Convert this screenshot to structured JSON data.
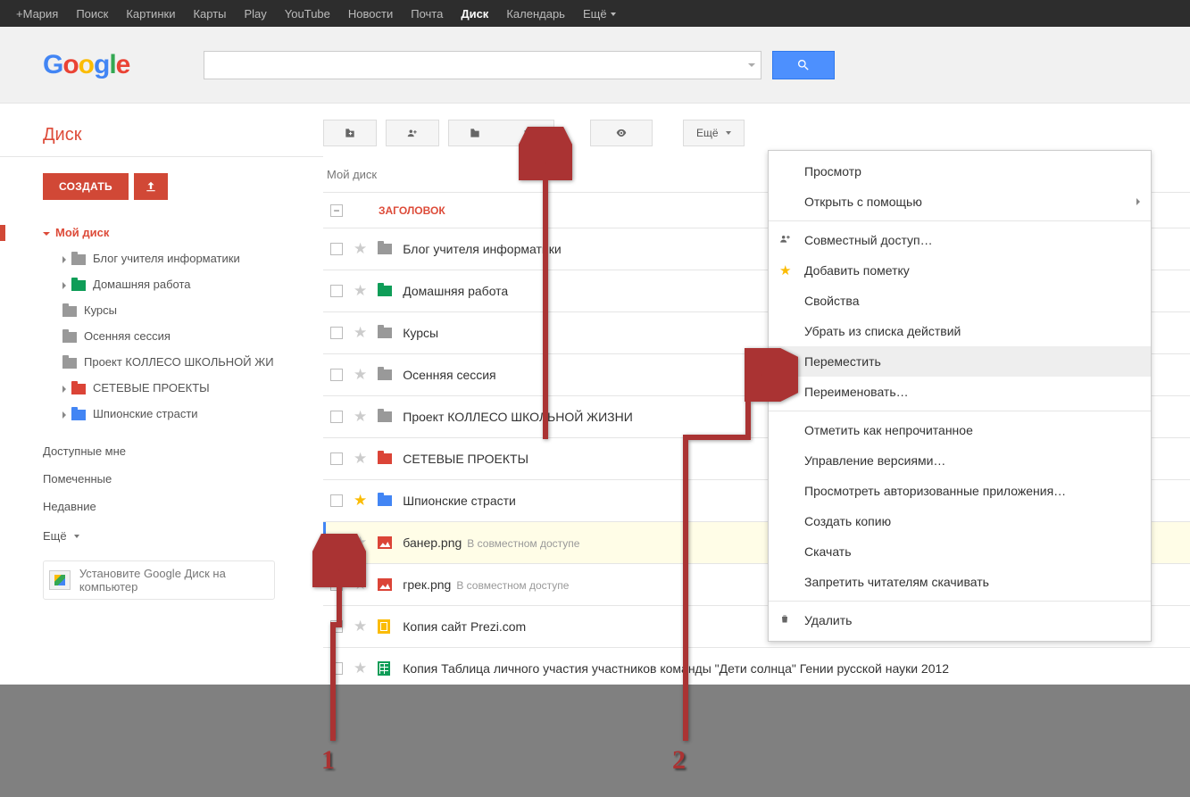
{
  "topbar": {
    "items": [
      "+Мария",
      "Поиск",
      "Картинки",
      "Карты",
      "Play",
      "YouTube",
      "Новости",
      "Почта",
      "Диск",
      "Календарь",
      "Ещё"
    ],
    "active_index": 8
  },
  "apptitle": "Диск",
  "toolbar": {
    "more_label": "Ещё"
  },
  "sidebar": {
    "create_label": "СОЗДАТЬ",
    "root_label": "Мой диск",
    "tree": [
      {
        "label": "Блог учителя информатики",
        "color": "gray",
        "expandable": true
      },
      {
        "label": "Домашняя работа",
        "color": "green",
        "expandable": true
      },
      {
        "label": "Курсы",
        "color": "gray",
        "expandable": false
      },
      {
        "label": "Осенняя сессия",
        "color": "gray",
        "expandable": false
      },
      {
        "label": "Проект КОЛЛЕСО ШКОЛЬНОЙ ЖИ",
        "color": "gray",
        "expandable": false
      },
      {
        "label": "СЕТЕВЫЕ ПРОЕКТЫ",
        "color": "red",
        "expandable": true
      },
      {
        "label": "Шпионские страсти",
        "color": "blue",
        "expandable": true
      }
    ],
    "sections": [
      "Доступные мне",
      "Помеченные",
      "Недавние"
    ],
    "more_label": "Ещё",
    "install_label": "Установите Google Диск на компьютер"
  },
  "content": {
    "breadcrumb": "Мой диск",
    "header_label": "ЗАГОЛОВОК",
    "shared_label": "В совместном доступе",
    "rows": [
      {
        "type": "folder",
        "color": "gray",
        "title": "Блог учителя информатики"
      },
      {
        "type": "folder",
        "color": "green",
        "title": "Домашняя работа"
      },
      {
        "type": "folder",
        "color": "gray",
        "title": "Курсы"
      },
      {
        "type": "folder",
        "color": "gray",
        "title": "Осенняя сессия"
      },
      {
        "type": "folder",
        "color": "gray",
        "title": "Проект КОЛЛЕСО ШКОЛЬНОЙ ЖИЗНИ"
      },
      {
        "type": "folder",
        "color": "red",
        "title": "СЕТЕВЫЕ ПРОЕКТЫ"
      },
      {
        "type": "folder",
        "color": "blue",
        "title": "Шпионские страсти",
        "starred": true
      },
      {
        "type": "image",
        "title": "банер.png",
        "shared": true,
        "selected": true
      },
      {
        "type": "image",
        "title": "грек.png",
        "shared": true
      },
      {
        "type": "doc",
        "title": "Копия сайт Prezi.com"
      },
      {
        "type": "sheet",
        "title": "Копия Таблица личного участия участников команды \"Дети солнца\"   Гении русской науки  2012"
      }
    ]
  },
  "dropdown": {
    "items": [
      {
        "label": "Просмотр"
      },
      {
        "label": "Открыть с помощью",
        "submenu": true
      },
      {
        "divider": true
      },
      {
        "label": "Совместный доступ…",
        "icon": "share"
      },
      {
        "label": "Добавить пометку",
        "icon": "star"
      },
      {
        "label": "Свойства"
      },
      {
        "label": "Убрать из списка действий"
      },
      {
        "label": "Переместить",
        "icon": "folder",
        "highlight": true
      },
      {
        "label": "Переименовать…"
      },
      {
        "divider": true
      },
      {
        "label": "Отметить как непрочитанное"
      },
      {
        "label": "Управление версиями…"
      },
      {
        "label": "Просмотреть авторизованные приложения…"
      },
      {
        "label": "Создать копию"
      },
      {
        "label": "Скачать"
      },
      {
        "label": "Запретить читателям скачивать"
      },
      {
        "divider": true
      },
      {
        "label": "Удалить",
        "icon": "trash"
      }
    ]
  },
  "annotations": {
    "n1": "1",
    "n2": "2"
  }
}
